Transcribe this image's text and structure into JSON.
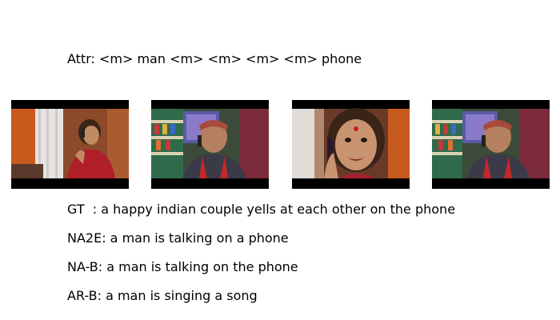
{
  "attr_line": "Attr: <m> man <m> <m> <m> <m> phone",
  "frames": [
    {
      "name": "video-frame-1",
      "scene": "woman on phone in room with orange wall and white curtain"
    },
    {
      "name": "video-frame-2",
      "scene": "man on phone in shop with shelves"
    },
    {
      "name": "video-frame-3",
      "scene": "close-up of woman on phone"
    },
    {
      "name": "video-frame-4",
      "scene": "man on phone in shop with shelves"
    }
  ],
  "captions": {
    "gt": "GT  : a happy indian couple yells at each other on the phone",
    "na2e": "NA2E: a man is talking on a phone",
    "nab": "NA-B: a man is talking on the phone",
    "arb": "AR-B: a man is singing a song"
  },
  "colors": {
    "background": "#ffffff",
    "text": "#000000",
    "letterbox": "#000000",
    "orange_wall": "#c85a1e",
    "red_outfit": "#b01e2a",
    "shop_green": "#2f6b4a"
  }
}
